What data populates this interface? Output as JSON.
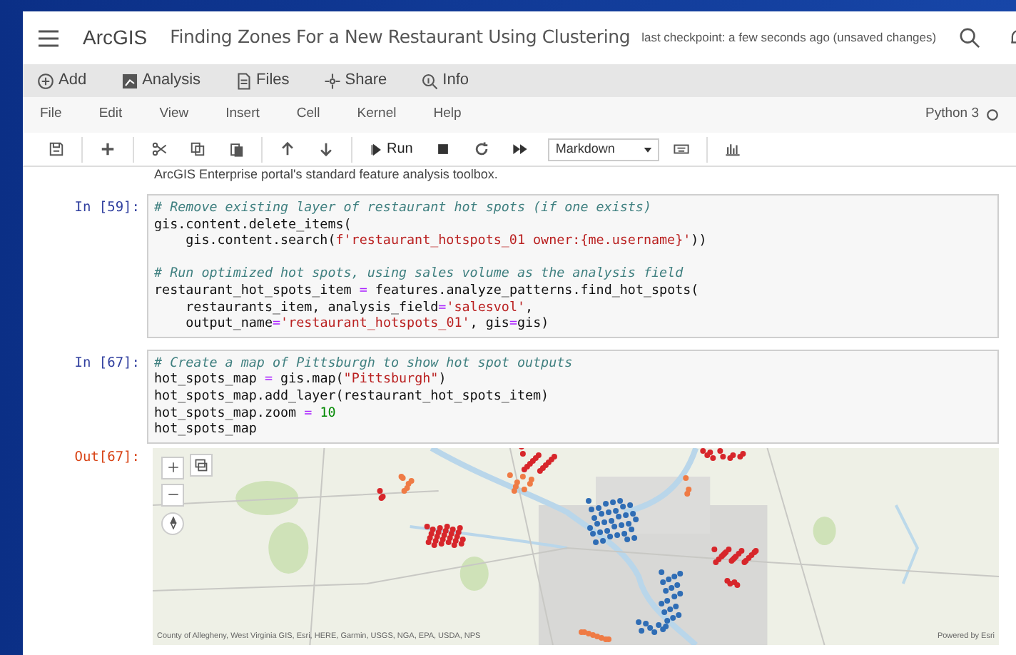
{
  "header": {
    "brand": "ArcGIS",
    "title": "Finding Zones For a New Restaurant Using Clustering",
    "checkpoint": "last checkpoint: a few seconds ago (unsaved changes)"
  },
  "actions": [
    {
      "label": "Add",
      "kind": "add"
    },
    {
      "label": "Analysis",
      "kind": "analysis"
    },
    {
      "label": "Files",
      "kind": "files"
    },
    {
      "label": "Share",
      "kind": "share"
    },
    {
      "label": "Info",
      "kind": "info"
    }
  ],
  "menu": [
    "File",
    "Edit",
    "View",
    "Insert",
    "Cell",
    "Kernel",
    "Help"
  ],
  "kernel": "Python 3",
  "toolbar": {
    "run": "Run",
    "cell_type": "Markdown"
  },
  "notebook": {
    "partial_text": "ArcGIS Enterprise portal's standard feature analysis toolbox.",
    "cells": [
      {
        "kind": "code",
        "prompt": "In [59]:",
        "blocks": [
          [
            [
              {
                "kind": "comment",
                "t": "# Remove existing layer of restaurant hot spots (if one exists)"
              }
            ],
            [
              {
                "kind": "code",
                "t": "gis.content.delete_items("
              }
            ],
            [
              {
                "kind": "code",
                "t": "    gis.content.search("
              },
              {
                "kind": "string",
                "t": "f'restaurant_hotspots_01 owner:{me.username}'"
              },
              {
                "kind": "code",
                "t": "))"
              }
            ]
          ],
          [
            [
              {
                "kind": "comment",
                "t": "# Run optimized hot spots, using sales volume as the analysis field"
              }
            ],
            [
              {
                "kind": "code",
                "t": "restaurant_hot_spots_item "
              },
              {
                "kind": "op",
                "t": "="
              },
              {
                "kind": "code",
                "t": " features.analyze_patterns.find_hot_spots("
              }
            ],
            [
              {
                "kind": "code",
                "t": "    restaurants_item, analysis_field"
              },
              {
                "kind": "op",
                "t": "="
              },
              {
                "kind": "string",
                "t": "'salesvol'"
              },
              {
                "kind": "code",
                "t": ","
              }
            ],
            [
              {
                "kind": "code",
                "t": "    output_name"
              },
              {
                "kind": "op",
                "t": "="
              },
              {
                "kind": "string",
                "t": "'restaurant_hotspots_01'"
              },
              {
                "kind": "code",
                "t": ", gis"
              },
              {
                "kind": "op",
                "t": "="
              },
              {
                "kind": "code",
                "t": "gis)"
              }
            ]
          ]
        ]
      },
      {
        "kind": "code",
        "prompt": "In [67]:",
        "blocks": [
          [
            [
              {
                "kind": "comment",
                "t": "# Create a map of Pittsburgh to show hot spot outputs"
              }
            ],
            [
              {
                "kind": "code",
                "t": "hot_spots_map "
              },
              {
                "kind": "op",
                "t": "="
              },
              {
                "kind": "code",
                "t": " gis.map("
              },
              {
                "kind": "string",
                "t": "\"Pittsburgh\""
              },
              {
                "kind": "code",
                "t": ")"
              }
            ],
            [
              {
                "kind": "code",
                "t": "hot_spots_map.add_layer(restaurant_hot_spots_item)"
              }
            ],
            [
              {
                "kind": "code",
                "t": "hot_spots_map.zoom "
              },
              {
                "kind": "op",
                "t": "= "
              },
              {
                "kind": "number",
                "t": "10"
              }
            ],
            [
              {
                "kind": "code",
                "t": "hot_spots_map"
              }
            ]
          ]
        ]
      },
      {
        "kind": "map",
        "prompt": "Out[67]:",
        "attribution": "County of Allegheny, West Virginia GIS, Esri, HERE, Garmin, USGS, NGA, EPA, USDA, NPS",
        "credit": "Powered by Esri"
      }
    ]
  }
}
